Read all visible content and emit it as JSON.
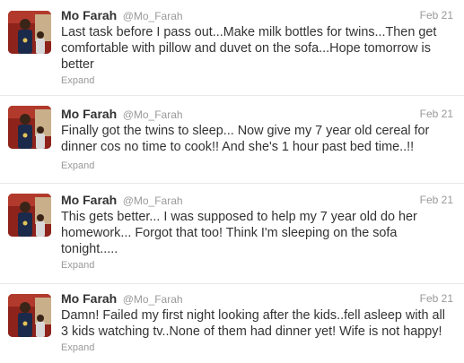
{
  "tweets": [
    {
      "name": "Mo Farah",
      "handle": "@Mo_Farah",
      "time": "Feb 21",
      "text": "Last task before I pass out...Make milk bottles for twins...Then get comfortable with pillow and duvet on the sofa...Hope tomorrow is better",
      "expand_label": "Expand"
    },
    {
      "name": "Mo Farah",
      "handle": "@Mo_Farah",
      "time": "Feb 21",
      "text": "Finally got the twins to sleep... Now give my 7 year old cereal for dinner cos no time to cook!! And she's 1 hour past bed time..!!",
      "expand_label": "Expand"
    },
    {
      "name": "Mo Farah",
      "handle": "@Mo_Farah",
      "time": "Feb 21",
      "text": "This gets better... I was supposed to help my 7 year old do her homework... Forgot that too! Think I'm sleeping on the sofa tonight.....",
      "expand_label": "Expand"
    },
    {
      "name": "Mo Farah",
      "handle": "@Mo_Farah",
      "time": "Feb 21",
      "text": "Damn! Failed my first night looking after the kids..fell asleep with all 3 kids watching tv..None of them had dinner yet! Wife is not happy!",
      "expand_label": "Expand"
    }
  ],
  "colors": {
    "name": "#333333",
    "meta": "#999999",
    "divider": "#e8e8e8"
  }
}
